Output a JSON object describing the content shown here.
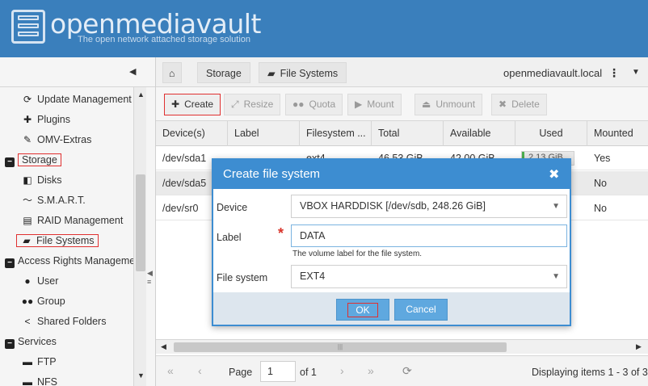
{
  "app": {
    "title": "openmediavault",
    "subtitle": "The open network attached storage solution"
  },
  "sidebar": {
    "items": [
      {
        "label": "Update Management",
        "icon": "refresh-icon"
      },
      {
        "label": "Plugins",
        "icon": "puzzle-icon"
      },
      {
        "label": "OMV-Extras",
        "icon": "wrench-icon"
      },
      {
        "label": "Storage",
        "icon": "minus-box-icon"
      },
      {
        "label": "Disks",
        "icon": "disk-icon"
      },
      {
        "label": "S.M.A.R.T.",
        "icon": "pulse-icon"
      },
      {
        "label": "RAID Management",
        "icon": "raid-icon"
      },
      {
        "label": "File Systems",
        "icon": "folders-icon"
      },
      {
        "label": "Access Rights Manageme",
        "icon": "minus-box-icon"
      },
      {
        "label": "User",
        "icon": "user-icon"
      },
      {
        "label": "Group",
        "icon": "group-icon"
      },
      {
        "label": "Shared Folders",
        "icon": "share-icon"
      },
      {
        "label": "Services",
        "icon": "minus-box-icon"
      },
      {
        "label": "FTP",
        "icon": "folder-icon"
      },
      {
        "label": "NFS",
        "icon": "folder-icon"
      }
    ]
  },
  "breadcrumb": {
    "home_icon": "home-icon",
    "storage": "Storage",
    "file_systems": "File Systems",
    "hostname": "openmediavault.local"
  },
  "toolbar": {
    "create": "Create",
    "resize": "Resize",
    "quota": "Quota",
    "mount": "Mount",
    "unmount": "Unmount",
    "delete": "Delete"
  },
  "grid": {
    "columns": [
      "Device(s)",
      "Label",
      "Filesystem ...",
      "Total",
      "Available",
      "Used",
      "Mounted"
    ],
    "rows": [
      {
        "device": "/dev/sda1",
        "label": "",
        "fs": "ext4",
        "total": "46.53 GiB",
        "available": "42.00 GiB",
        "used": "2.13 GiB",
        "used_fraction": 0.05,
        "mounted": "Yes"
      },
      {
        "device": "/dev/sda5",
        "label": "",
        "fs": "",
        "total": "",
        "available": "",
        "used": "",
        "used_fraction": 0,
        "mounted": "No"
      },
      {
        "device": "/dev/sr0",
        "label": "",
        "fs": "",
        "total": "",
        "available": "",
        "used": "",
        "used_fraction": 0,
        "mounted": "No"
      }
    ]
  },
  "paging": {
    "page_label": "Page",
    "page_value": "1",
    "of_label": "of 1",
    "status": "Displaying items 1 - 3 of 3"
  },
  "dialog": {
    "title": "Create file system",
    "device_label": "Device",
    "device_value": "VBOX HARDDISK [/dev/sdb, 248.26 GiB]",
    "label_label": "Label",
    "label_value": "DATA",
    "label_hint": "The volume label for the file system.",
    "filesystem_label": "File system",
    "filesystem_value": "EXT4",
    "ok": "OK",
    "cancel": "Cancel"
  },
  "colors": {
    "header": "#3a7fbc",
    "dialog_header": "#3d8dd1",
    "button": "#5fa8df",
    "highlight": "#e03030"
  }
}
